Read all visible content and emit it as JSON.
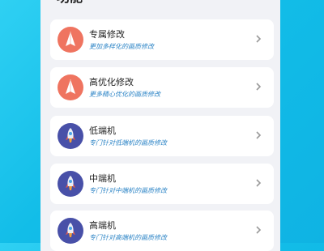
{
  "section": {
    "title": "功能"
  },
  "colors": {
    "background": "#12bde8",
    "panel": "#f1f2f6",
    "card": "#ffffff",
    "subtitle_text": "#2f86c7",
    "icon_paper_bg": "#ef7460",
    "icon_rocket_bg": "#4850a8"
  },
  "items": [
    {
      "icon": "paper-plane-icon",
      "title": "专属修改",
      "subtitle": "更加多样化的画质修改"
    },
    {
      "icon": "paper-plane-icon",
      "title": "高优化修改",
      "subtitle": "更多精心优化的画质修改"
    },
    {
      "icon": "rocket-icon",
      "title": "低端机",
      "subtitle": "专门针对低端机的画质修改"
    },
    {
      "icon": "rocket-icon",
      "title": "中端机",
      "subtitle": "专门针对中端机的画质修改"
    },
    {
      "icon": "rocket-icon",
      "title": "高端机",
      "subtitle": "专门针对高端机的画质修改"
    }
  ]
}
